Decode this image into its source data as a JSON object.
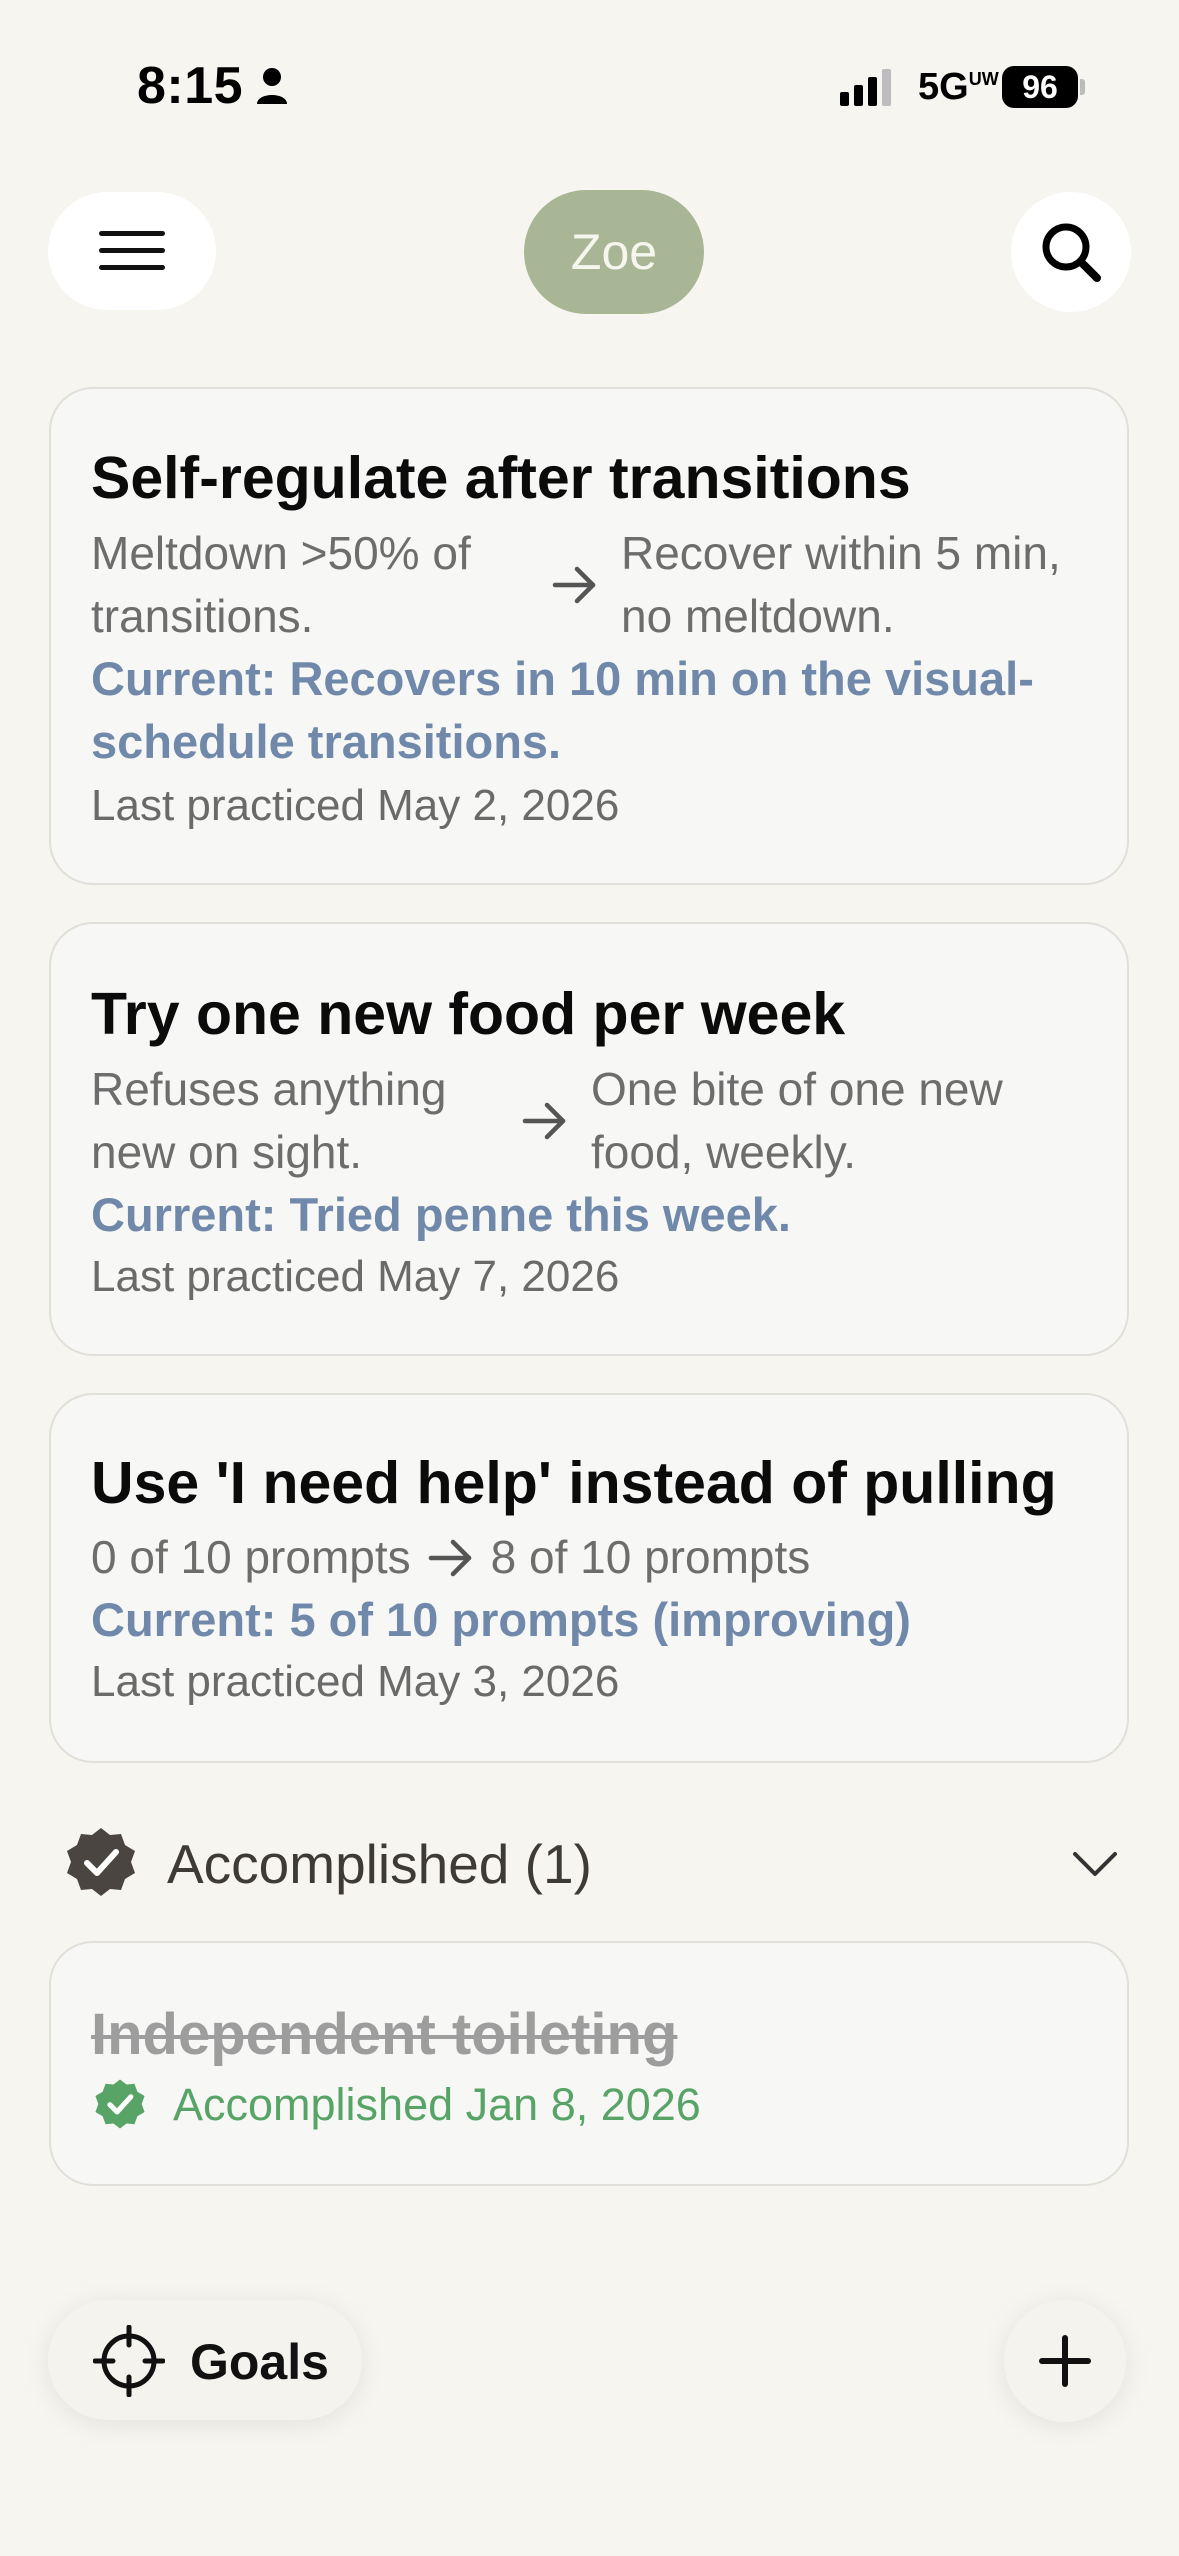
{
  "status_bar": {
    "time": "8:15",
    "network": "5G",
    "network_superscript": "UW",
    "battery": "96"
  },
  "header": {
    "profile_name": "Zoe",
    "menu_icon": "hamburger-icon",
    "search_icon": "search-icon"
  },
  "goals": [
    {
      "title": "Self-regulate after transitions",
      "baseline": "Meltdown >50% of transitions.",
      "target": "Recover within 5 min, no meltdown.",
      "current": "Current: Recovers in 10 min on the visual-schedule transitions.",
      "last_practiced": "Last practiced May 2, 2026"
    },
    {
      "title": "Try one new food per week",
      "baseline": "Refuses anything new on sight.",
      "target": "One bite of one new food, weekly.",
      "current": "Current: Tried penne this week.",
      "last_practiced": "Last practiced May 7, 2026"
    },
    {
      "title": "Use 'I need help' instead of pulling",
      "baseline": "0 of 10 prompts",
      "target": "8 of 10 prompts",
      "current": "Current: 5 of 10 prompts (improving)",
      "last_practiced": "Last practiced May 3, 2026"
    }
  ],
  "accomplished": {
    "header_label": "Accomplished (1)",
    "items": [
      {
        "title": "Independent toileting",
        "date": "Accomplished Jan 8, 2026"
      }
    ]
  },
  "bottom_bar": {
    "goals_label": "Goals",
    "add_icon": "plus-icon"
  },
  "colors": {
    "background": "#f7f5f0",
    "profile_pill": "#a9b696",
    "current_text": "#7089aa",
    "accomplished_green": "#58a466",
    "badge_dark": "#4a4541"
  }
}
